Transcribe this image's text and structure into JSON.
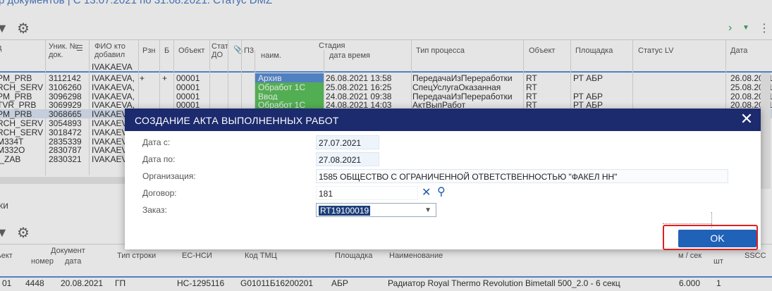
{
  "background": {
    "title": "р документов | С 13.07.2021 по 31.08.2021. Статус DMZ",
    "lower_section_title": "ки",
    "top_headers": {
      "c0": "д",
      "uniq_num": "Уник. № док.",
      "fio": "ФИО кто добавил",
      "fio_sub": "IVAKAEVA",
      "rzn": "Рзн",
      "b": "Б",
      "object": "Объект",
      "stat": "Стат ДО",
      "pz": "П3",
      "stage": "Стадия",
      "stage_name": "наим.",
      "stage_date": "дата время",
      "process": "Тип процесса",
      "object2": "Объект",
      "site": "Площадка",
      "status_lv": "Статус LV",
      "date": "Дата"
    },
    "rows": [
      {
        "c0": "PM_PRB",
        "num": "3112142",
        "fio": "IVAKAEVA,",
        "rzn": "+",
        "b": "+",
        "obj": "00001",
        "stage": "Архив",
        "stage_color": "#5b8fd6",
        "dt": "26.08.2021 13:58",
        "proc": "ПередачаИзПереработки",
        "obj2": "RT",
        "site": "РТ АБР",
        "date": "26.08.2021"
      },
      {
        "c0": "RCH_SERV",
        "num": "3106260",
        "fio": "IVAKAEVA,",
        "rzn": "",
        "b": "",
        "obj": "00001",
        "stage": "Обработ 1С",
        "stage_color": "#5cc25c",
        "dt": "25.08.2021 16:25",
        "proc": "СпецУслугаОказанная",
        "obj2": "RT",
        "site": "",
        "date": "25.08.2021"
      },
      {
        "c0": "PM_PRB",
        "num": "3096298",
        "fio": "IVAKAEVA,",
        "rzn": "",
        "b": "",
        "obj": "00001",
        "stage": "Ввод",
        "stage_color": "#5cc25c",
        "dt": "24.08.2021 09:38",
        "proc": "ПередачаИзПереработки",
        "obj2": "RT",
        "site": "РТ АБР",
        "date": "20.08.2021"
      },
      {
        "c0": "TVR_PRB",
        "num": "3069929",
        "fio": "IVAKAEVA,",
        "rzn": "",
        "b": "",
        "obj": "00001",
        "stage": "Обработ 1С",
        "stage_color": "#5cc25c",
        "dt": "24.08.2021 14:03",
        "proc": "АктВыпРабот",
        "obj2": "RT",
        "site": "РТ АБР",
        "date": "20.08.2021"
      },
      {
        "c0": "PM_PRB",
        "num": "3068665",
        "fio": "IVAKAEV",
        "rzn": "",
        "b": "",
        "obj": "",
        "stage": "",
        "stage_color": "",
        "dt": "",
        "proc": "",
        "obj2": "",
        "site": "",
        "date": ""
      },
      {
        "c0": "RCH_SERV",
        "num": "3054893",
        "fio": "IVAKAEV",
        "rzn": "",
        "b": "",
        "obj": "",
        "stage": "",
        "stage_color": "",
        "dt": "",
        "proc": "",
        "obj2": "",
        "site": "",
        "date": ""
      },
      {
        "c0": "RCH_SERV",
        "num": "3018472",
        "fio": "IVAKAEV",
        "rzn": "",
        "b": "",
        "obj": "",
        "stage": "",
        "stage_color": "",
        "dt": "",
        "proc": "",
        "obj2": "",
        "site": "",
        "date": ""
      },
      {
        "c0": "M334T",
        "num": "2835339",
        "fio": "IVAKAEV",
        "rzn": "",
        "b": "",
        "obj": "",
        "stage": "",
        "stage_color": "",
        "dt": "",
        "proc": "",
        "obj2": "",
        "site": "",
        "date": ""
      },
      {
        "c0": "M332O",
        "num": "2830787",
        "fio": "IVAKAEV",
        "rzn": "",
        "b": "",
        "obj": "",
        "stage": "",
        "stage_color": "",
        "dt": "",
        "proc": "",
        "obj2": "",
        "site": "",
        "date": ""
      },
      {
        "c0": "I_ZAB",
        "num": "2830321",
        "fio": "IVAKAEV",
        "rzn": "",
        "b": "",
        "obj": "",
        "stage": "",
        "stage_color": "",
        "dt": "",
        "proc": "",
        "obj2": "",
        "site": "",
        "date": ""
      }
    ],
    "bottom_headers": {
      "obj": "ьект",
      "doc": "Документ",
      "doc_num": "номер",
      "doc_date": "дата",
      "type_row": "Тип строки",
      "ecnsi": "ЕС-НСИ",
      "tmc": "Код ТМЦ",
      "site": "Площадка",
      "name": "Наименование",
      "m_sec": "м / сек",
      "sht": "шт",
      "sscc": "SSCC"
    },
    "bottom_row": {
      "c0": "01",
      "num": "4448",
      "date": "20.08.2021",
      "type": "ГП",
      "ecnsi": "HC-1295116",
      "tmc": "G01011Б16200201",
      "site": "АБР",
      "name": "Радиатор Royal Thermo Revolution Bimetall 500_2.0 - 6 секц",
      "qty": "6.000",
      "sht": "1"
    }
  },
  "dialog": {
    "title": "СОЗДАНИЕ АКТА ВЫПОЛНЕННЫХ РАБОТ",
    "close_icon": "close-icon",
    "fields": {
      "date_from_label": "Дата с:",
      "date_from_value": "27.07.2021",
      "date_to_label": "Дата по:",
      "date_to_value": "27.08.2021",
      "org_label": "Организация:",
      "org_value": "1585 ОБЩЕСТВО С ОГРАНИЧЕННОЙ ОТВЕТСТВЕННОСТЬЮ \"ФАКЕЛ НН\"",
      "contract_label": "Договор:",
      "contract_value": "181",
      "order_label": "Заказ:",
      "order_value": "RT19100019"
    },
    "ok_label": "OK",
    "accent_color": "#1c2a6e",
    "button_color": "#1f62b8",
    "highlight_color": "#e0201e"
  }
}
